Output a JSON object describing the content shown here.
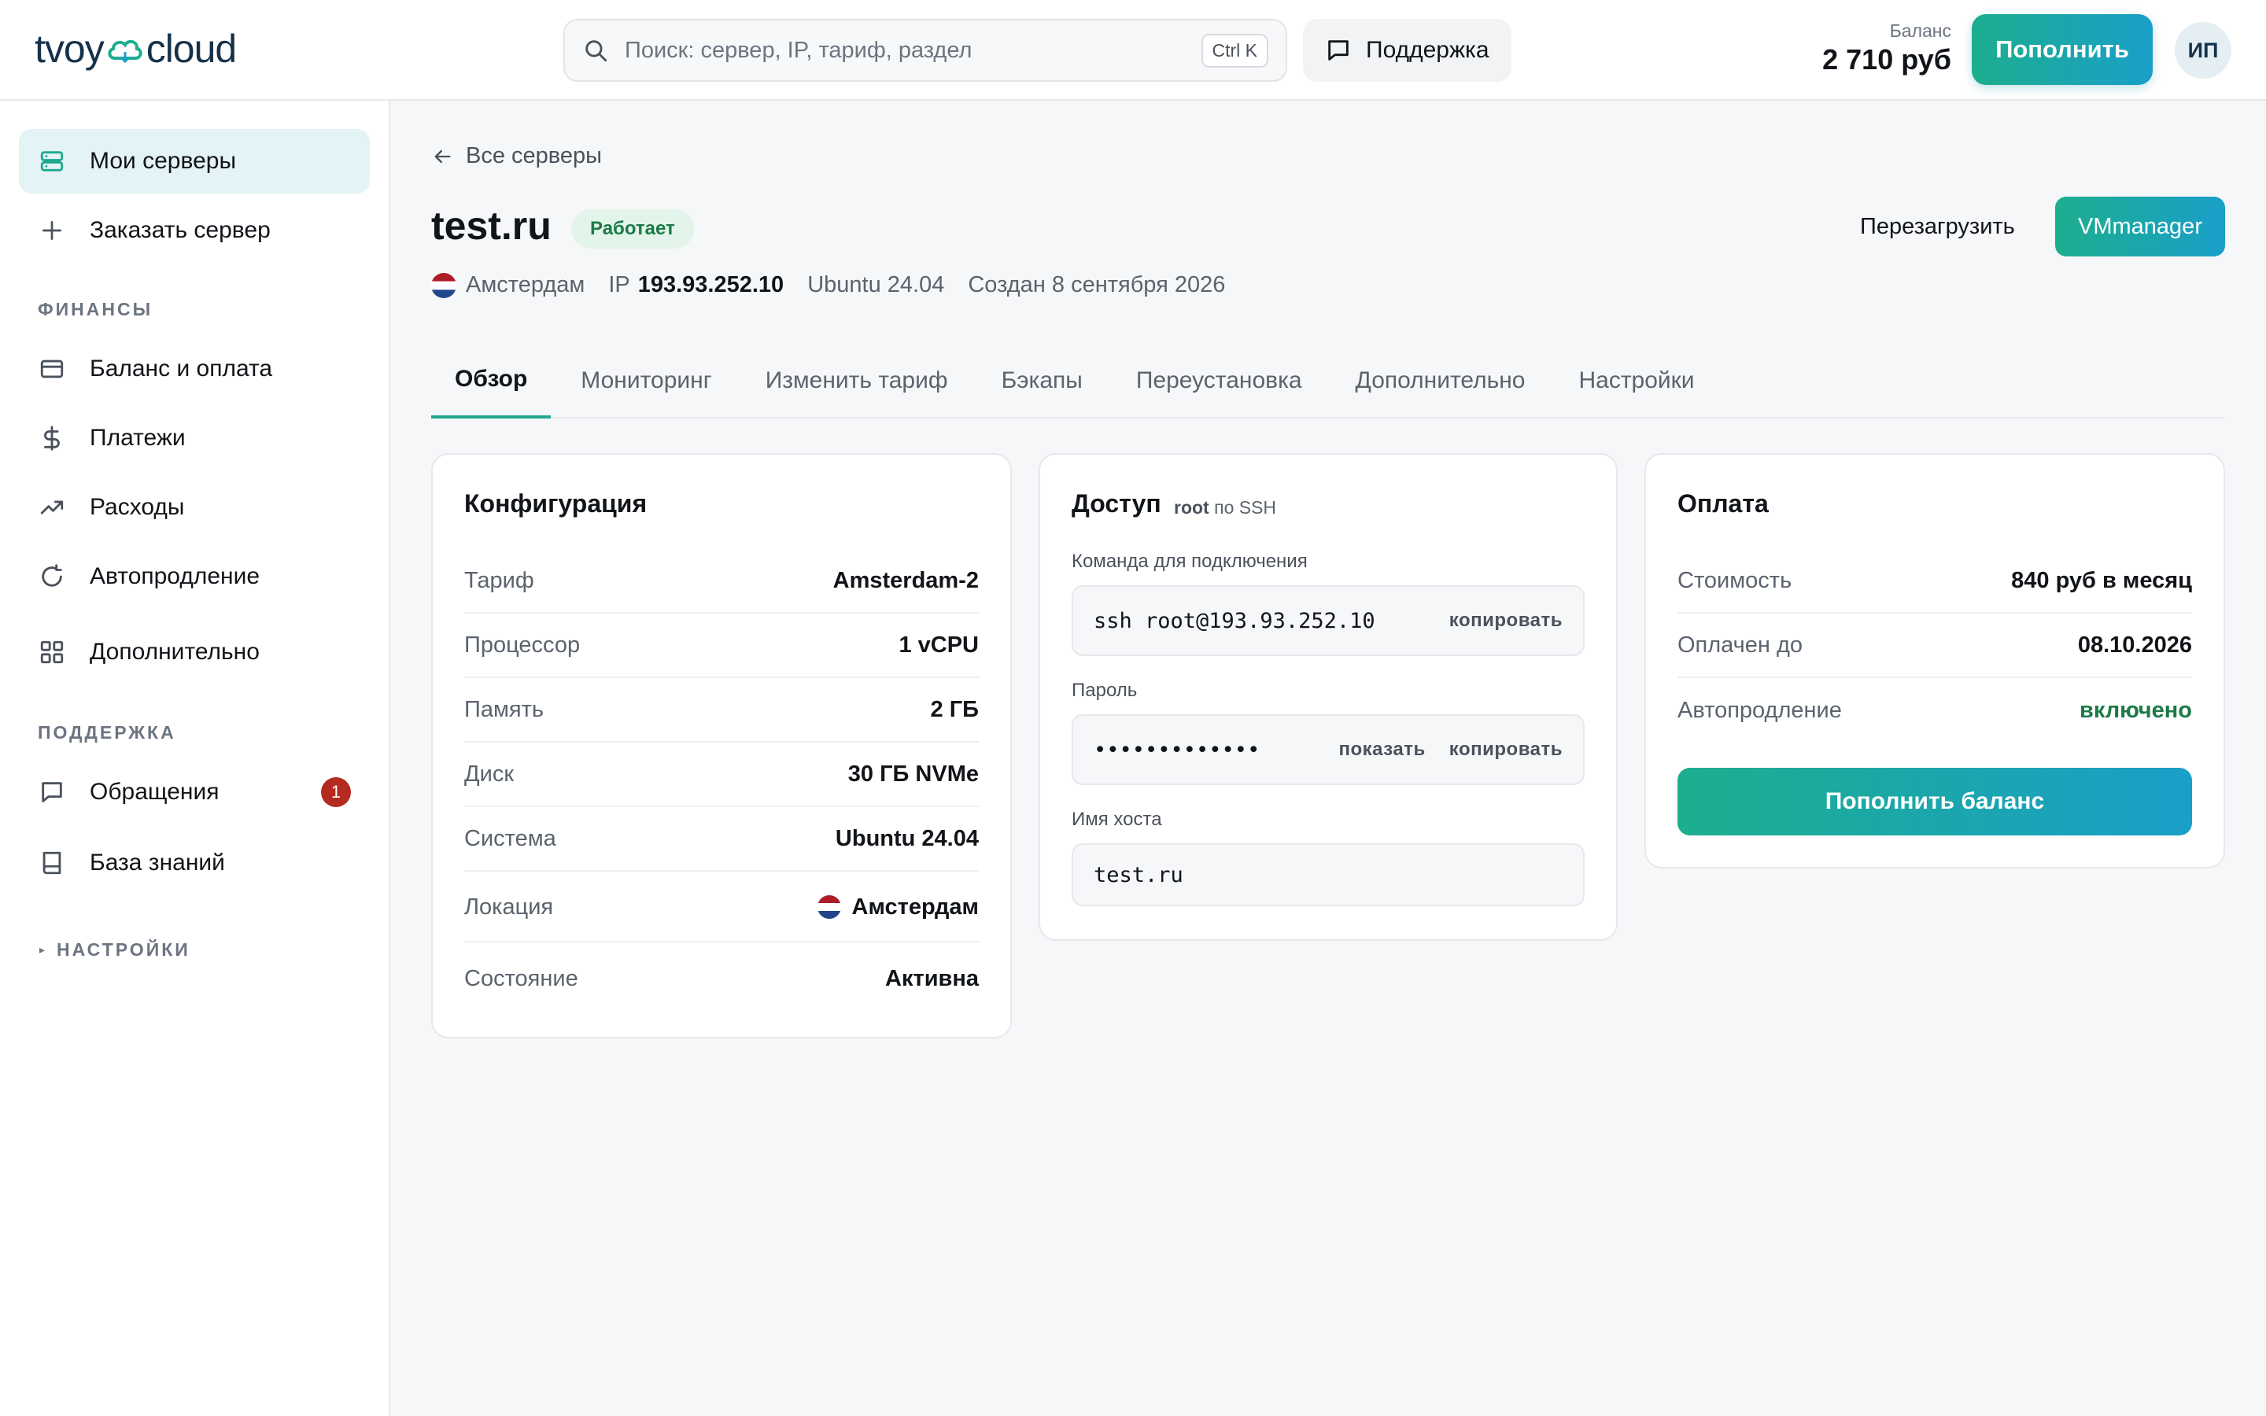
{
  "header": {
    "logo_left": "tvoy",
    "logo_right": "cloud",
    "search_placeholder": "Поиск: сервер, IP, тариф, раздел",
    "search_shortcut": "Ctrl K",
    "support_label": "Поддержка",
    "balance_label": "Баланс",
    "balance_value": "2 710 руб",
    "topup_label": "Пополнить",
    "avatar_initials": "ИП"
  },
  "sidebar": {
    "items_top": [
      {
        "label": "Мои серверы",
        "icon": "server-icon",
        "active": true
      },
      {
        "label": "Заказать сервер",
        "icon": "plus-icon"
      }
    ],
    "section_finance": "ФИНАНСЫ",
    "finance_items": [
      {
        "label": "Баланс и оплата",
        "icon": "card-icon"
      },
      {
        "label": "Платежи",
        "icon": "dollar-icon"
      },
      {
        "label": "Расходы",
        "icon": "trend-icon"
      },
      {
        "label": "Автопродление",
        "icon": "refresh-icon"
      },
      {
        "label": "Дополнительно",
        "icon": "grid-icon"
      }
    ],
    "section_support": "ПОДДЕРЖКА",
    "support_items": [
      {
        "label": "Обращения",
        "icon": "chat-icon",
        "badge": "1"
      },
      {
        "label": "База знаний",
        "icon": "book-icon"
      }
    ],
    "section_settings": "НАСТРОЙКИ"
  },
  "main": {
    "back_label": "Все серверы",
    "server_name": "test.ru",
    "status": "Работает",
    "reboot_label": "Перезагрузить",
    "vmmanager_label": "VMmanager",
    "meta": {
      "location": "Амстердам",
      "ip_label": "IP",
      "ip": "193.93.252.10",
      "os": "Ubuntu 24.04",
      "created": "Создан 8 сентября 2026"
    },
    "tabs": [
      "Обзор",
      "Мониторинг",
      "Изменить тариф",
      "Бэкапы",
      "Переустановка",
      "Дополнительно",
      "Настройки"
    ],
    "config": {
      "title": "Конфигурация",
      "rows": [
        {
          "k": "Тариф",
          "v": "Amsterdam-2"
        },
        {
          "k": "Процессор",
          "v": "1 vCPU"
        },
        {
          "k": "Память",
          "v": "2 ГБ"
        },
        {
          "k": "Диск",
          "v": "30 ГБ NVMe"
        },
        {
          "k": "Система",
          "v": "Ubuntu 24.04"
        },
        {
          "k": "Локация",
          "v": "Амстердам"
        },
        {
          "k": "Состояние",
          "v": "Активна"
        }
      ]
    },
    "access": {
      "title": "Доступ",
      "hint_user": "root",
      "hint_rest": "по SSH",
      "cmd_label": "Команда для подключения",
      "cmd_value": "ssh root@193.93.252.10",
      "copy_label": "копировать",
      "pass_label": "Пароль",
      "pass_value": "•••••••••••••",
      "show_label": "показать",
      "host_label": "Имя хоста",
      "host_value": "test.ru"
    },
    "billing": {
      "title": "Оплата",
      "rows": [
        {
          "k": "Стоимость",
          "v": "840 руб в месяц"
        },
        {
          "k": "Оплачен до",
          "v": "08.10.2026"
        },
        {
          "k": "Автопродление",
          "v": "включено"
        }
      ],
      "button": "Пополнить баланс"
    }
  },
  "colors": {
    "accent_start": "#1cae8e",
    "accent_end": "#1a9fc9",
    "status_green": "#1b7a47",
    "badge_red": "#b32a1f"
  }
}
